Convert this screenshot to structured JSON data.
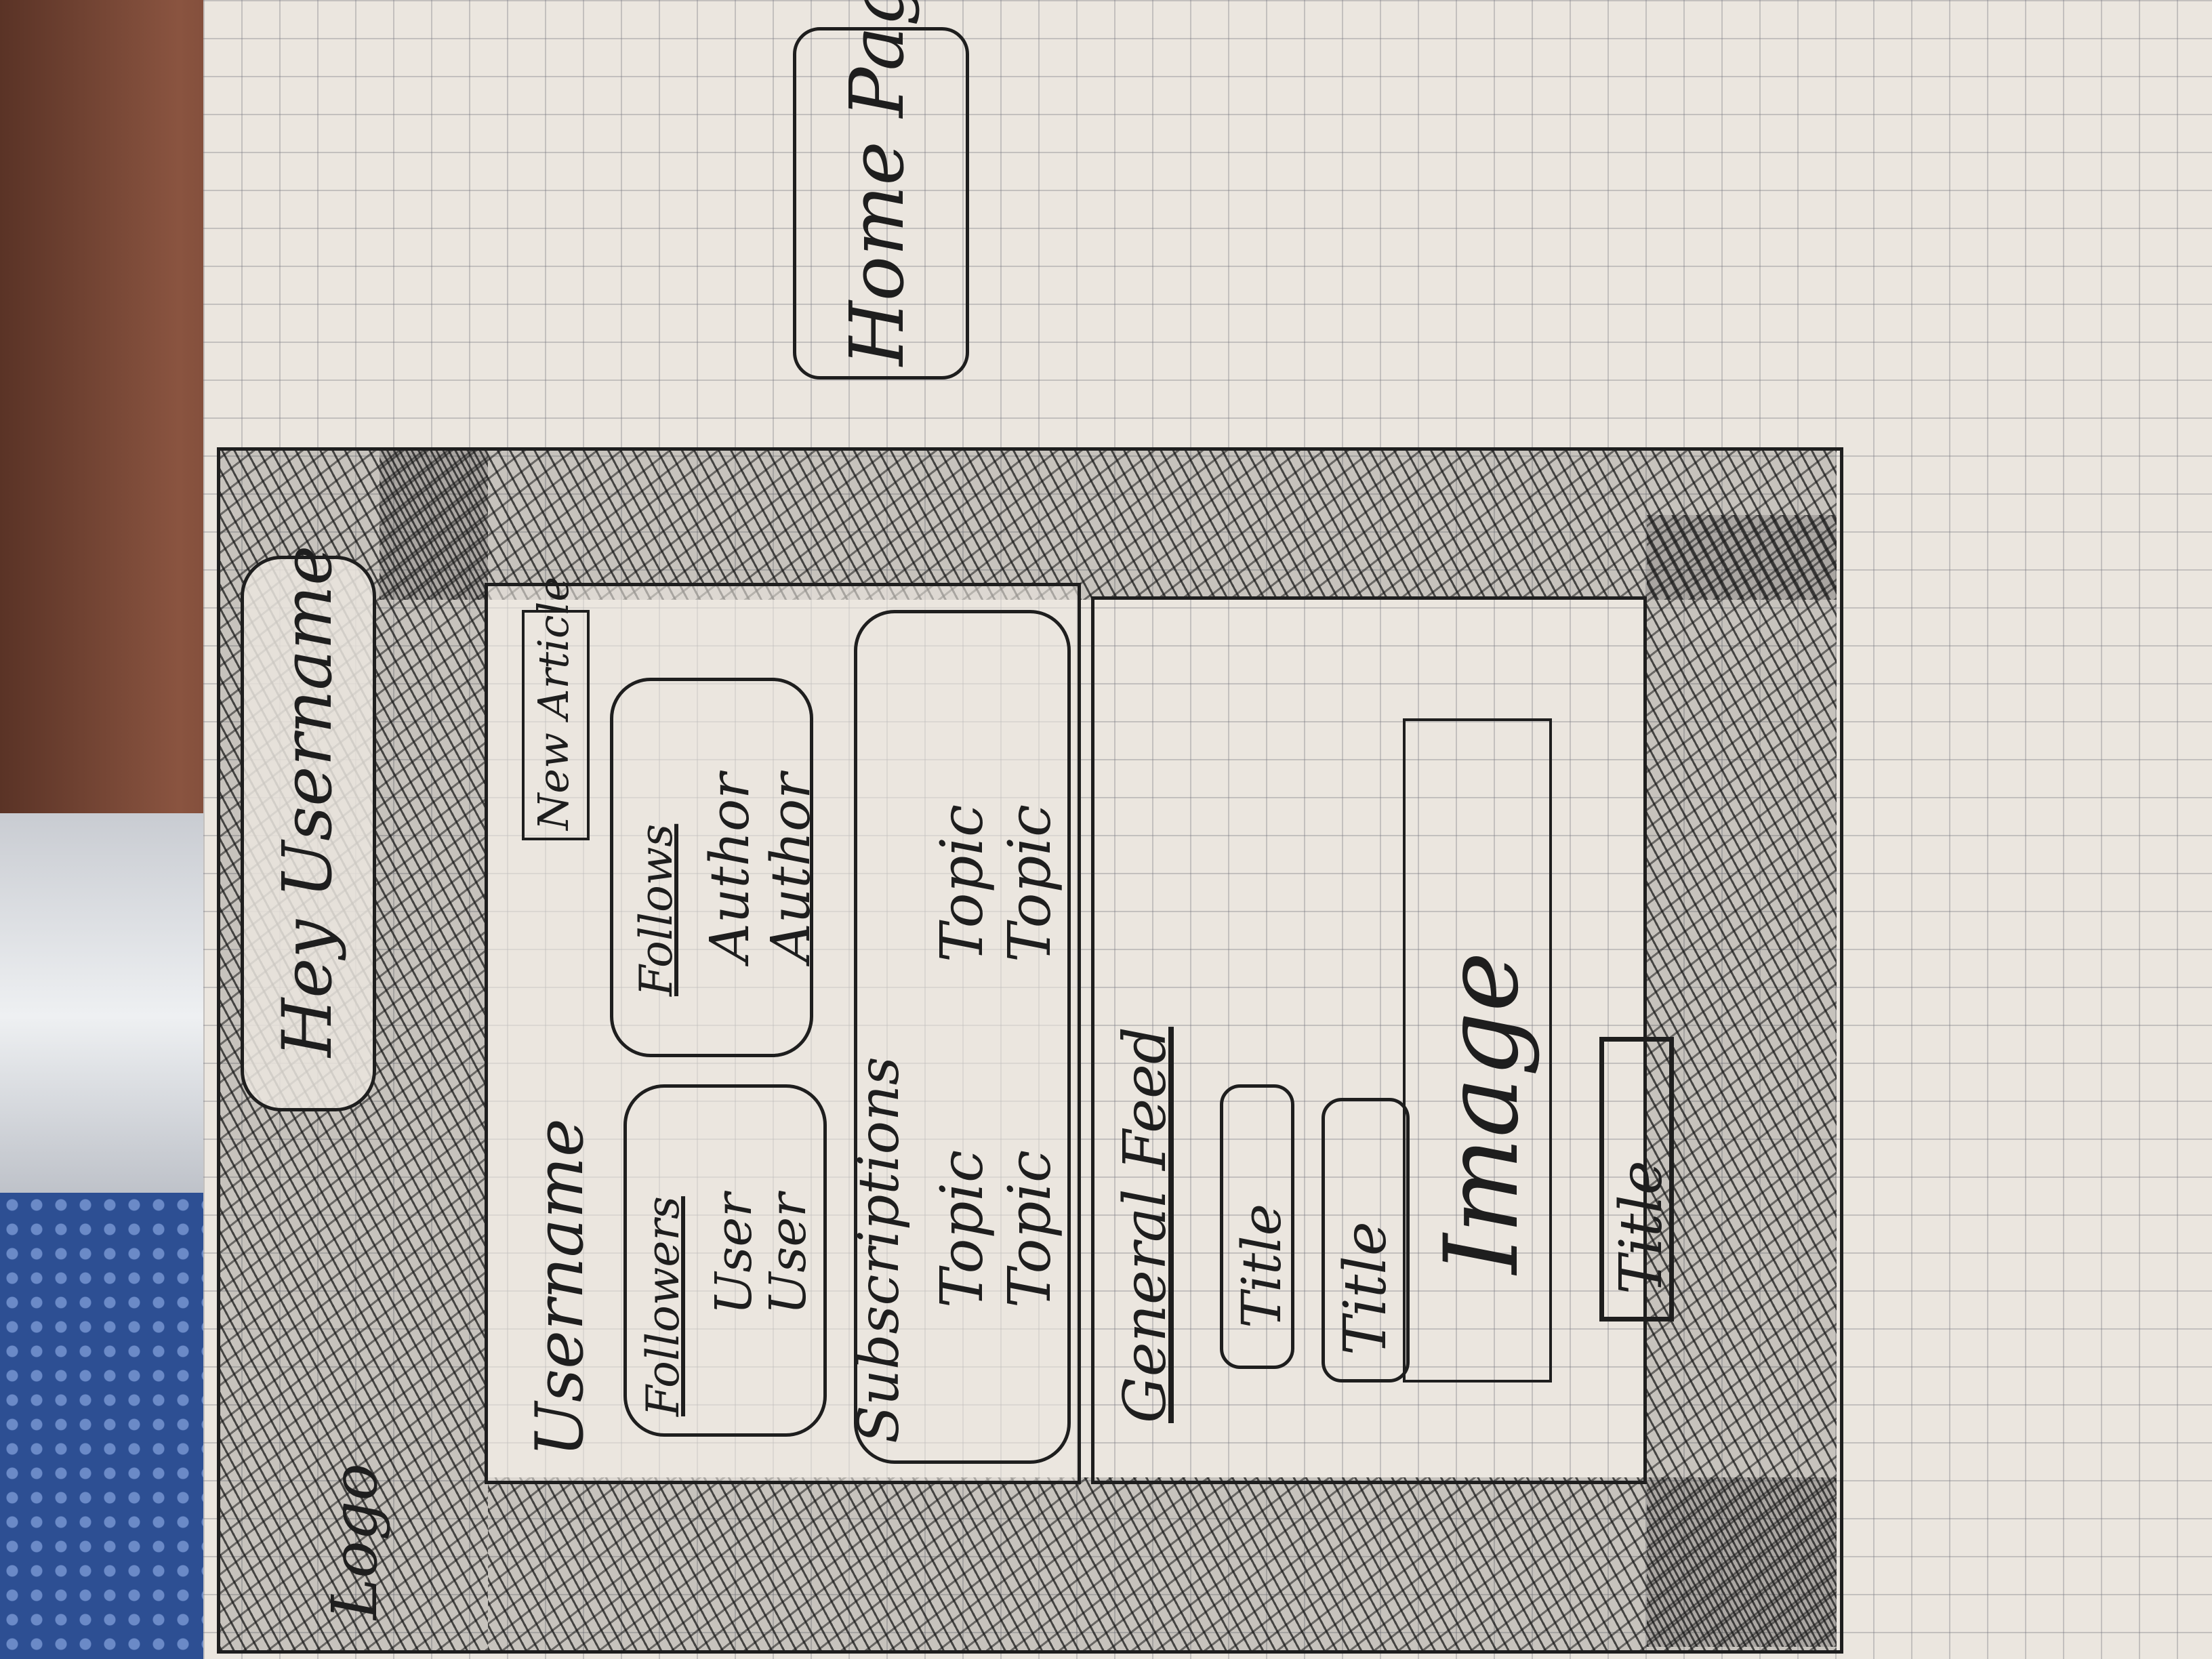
{
  "title": "Home Page",
  "header": {
    "logo": "Logo",
    "greeting": "Hey Username"
  },
  "sidebar": {
    "username": "Username",
    "new_article": "New Article",
    "followers": {
      "label": "Followers",
      "items": [
        "User",
        "User"
      ]
    },
    "follows": {
      "label": "Follows",
      "items": [
        "Author",
        "Author"
      ]
    },
    "subscriptions": {
      "label": "Subscriptions",
      "topics": [
        "Topic",
        "Topic",
        "Topic",
        "Topic"
      ]
    }
  },
  "feed": {
    "label": "General Feed",
    "cards": [
      {
        "title": "Title"
      },
      {
        "title": "Title"
      }
    ],
    "article": {
      "image": "Image",
      "title": "Title"
    }
  }
}
